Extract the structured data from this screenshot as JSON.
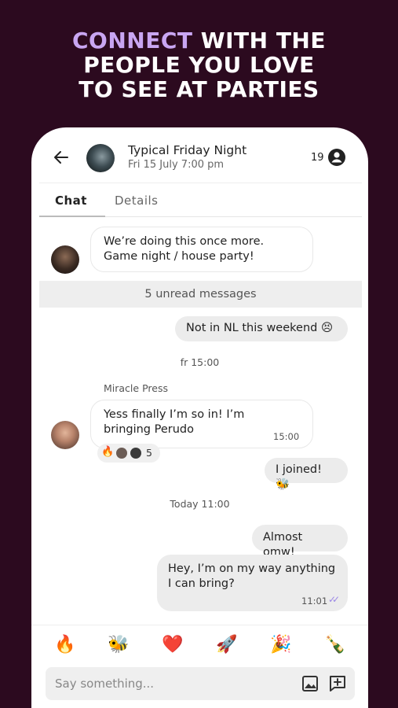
{
  "headline": {
    "accent": "CONNECT",
    "line1_rest": " WITH THE",
    "line2": "PEOPLE YOU LOVE",
    "line3": "TO SEE AT PARTIES"
  },
  "header": {
    "title": "Typical Friday Night",
    "subtitle": "Fri 15 July 7:00 pm",
    "member_count": "19"
  },
  "tabs": [
    {
      "label": "Chat",
      "active": true
    },
    {
      "label": "Details",
      "active": false
    }
  ],
  "messages": {
    "m1": "We’re doing this once more. Game night / house party!",
    "unread_banner": "5 unread messages",
    "m2": "Not in NL this weekend 😣",
    "sep1": "fr 15:00",
    "sender": "Miracle Press",
    "m3": "Yess finally I’m so in! I’m bringing Perudo",
    "m3_time": "15:00",
    "m3_reactions_count": "5",
    "m4": "I joined! 🐝",
    "sep2": "Today 11:00",
    "m5": "Almost omw!",
    "m6": "Hey, I’m on my way anything I can bring?",
    "m6_time": "11:01"
  },
  "emoji_bar": [
    "🔥",
    "🐝",
    "❤️",
    "🚀",
    "🎉",
    "🍾"
  ],
  "composer": {
    "placeholder": "Say something..."
  },
  "colors": {
    "background": "#2c0a1f",
    "accent": "#c9a6f2",
    "read_ticks": "#9b87e6"
  }
}
